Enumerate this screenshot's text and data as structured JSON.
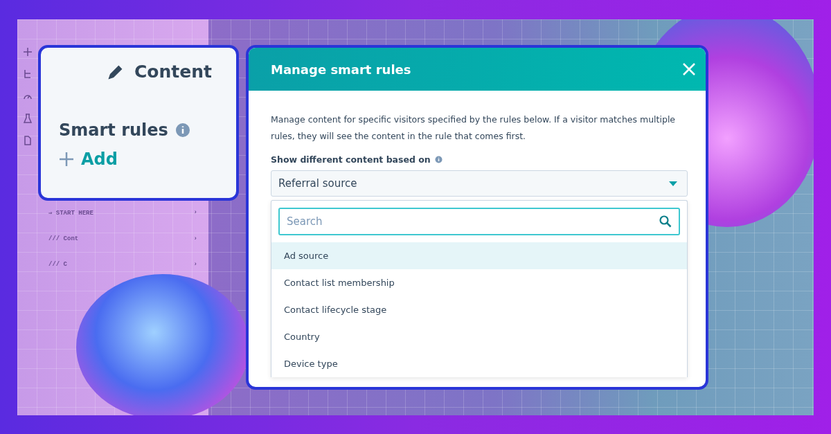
{
  "background_rows": [
    {
      "label": "⇒ START HERE",
      "chevron": "›"
    },
    {
      "label": "/// Cont",
      "chevron": "›"
    },
    {
      "label": "/// C",
      "chevron": "›"
    }
  ],
  "content_panel": {
    "title": "Content",
    "section": "Smart rules",
    "add_label": "Add"
  },
  "modal": {
    "title": "Manage smart rules",
    "description": "Manage content for specific visitors specified by the rules below. If a visitor matches multiple rules, they will see the content in the rule that comes first.",
    "field_label": "Show different content based on",
    "select_value": "Referral source",
    "search": {
      "placeholder": "Search"
    },
    "options": [
      {
        "label": "Ad source",
        "selected": true
      },
      {
        "label": "Contact list membership",
        "selected": false
      },
      {
        "label": "Contact lifecycle stage",
        "selected": false
      },
      {
        "label": "Country",
        "selected": false
      },
      {
        "label": "Device type",
        "selected": false
      }
    ]
  }
}
